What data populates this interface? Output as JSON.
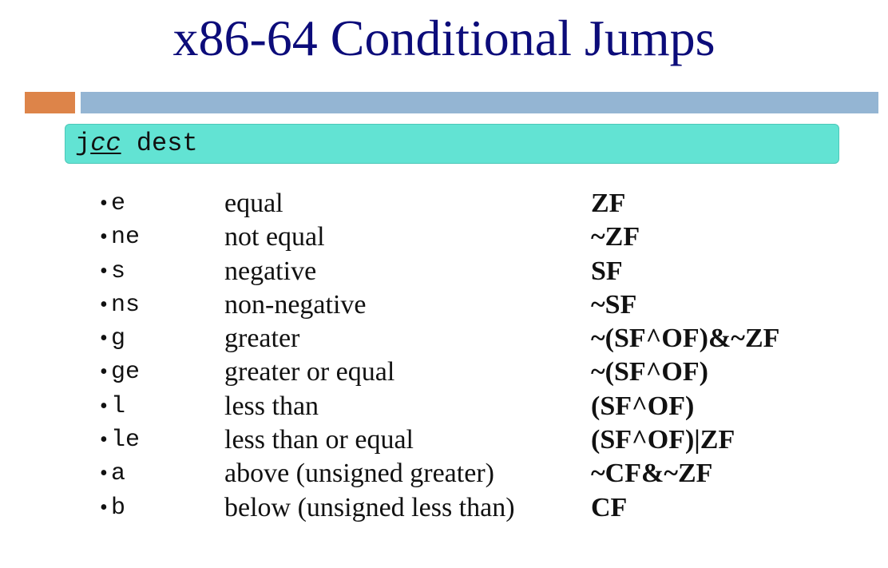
{
  "slide": {
    "title": "x86-64 Conditional Jumps",
    "colors": {
      "title": "#0c0c7a",
      "accent_orange": "#dd8449",
      "accent_blue": "#94b5d3",
      "code_box": "#62e3d3"
    }
  },
  "syntax": {
    "prefix": "j",
    "placeholder": "cc",
    "operand": " dest"
  },
  "conditions": [
    {
      "bullet": "•",
      "suffix": "e",
      "meaning": "equal",
      "flags": "ZF"
    },
    {
      "bullet": "•",
      "suffix": "ne",
      "meaning": "not equal",
      "flags": "~ZF"
    },
    {
      "bullet": "•",
      "suffix": "s",
      "meaning": "negative",
      "flags": "SF"
    },
    {
      "bullet": "•",
      "suffix": "ns",
      "meaning": "non-negative",
      "flags": "~SF"
    },
    {
      "bullet": "•",
      "suffix": "g",
      "meaning": "greater",
      "flags": "~(SF^OF)&~ZF"
    },
    {
      "bullet": "•",
      "suffix": "ge",
      "meaning": "greater or equal",
      "flags": "~(SF^OF)"
    },
    {
      "bullet": "•",
      "suffix": "l",
      "meaning": "less than",
      "flags": "(SF^OF)"
    },
    {
      "bullet": "•",
      "suffix": "le",
      "meaning": "less than or equal",
      "flags": "(SF^OF)|ZF"
    },
    {
      "bullet": "•",
      "suffix": "a",
      "meaning": "above (unsigned greater)",
      "flags": "~CF&~ZF"
    },
    {
      "bullet": "•",
      "suffix": "b",
      "meaning": "below (unsigned less than)",
      "flags": "CF"
    }
  ]
}
